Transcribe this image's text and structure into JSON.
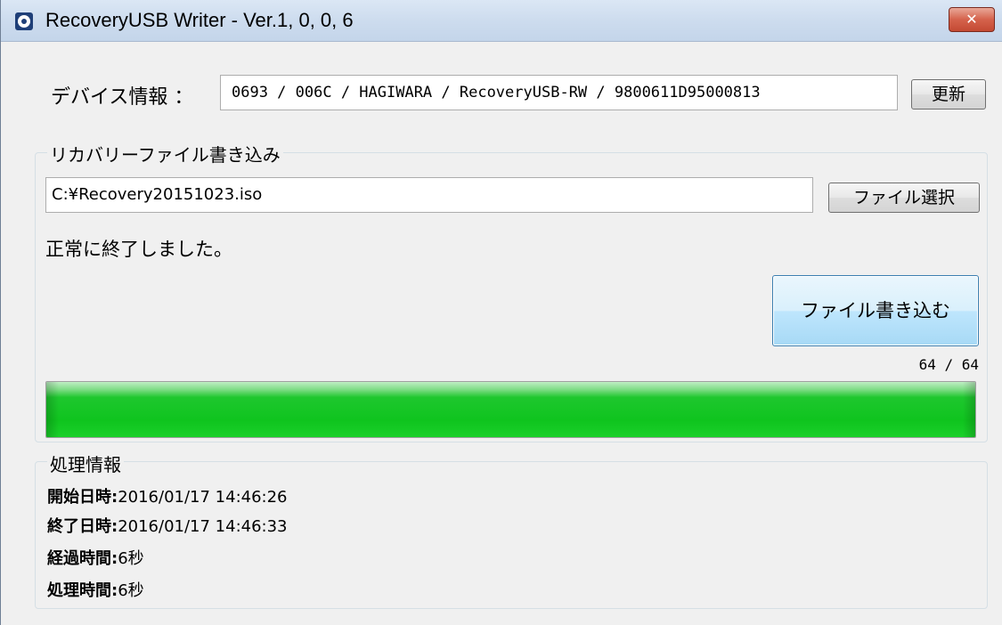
{
  "window": {
    "title": "RecoveryUSB Writer - Ver.1, 0, 0, 6",
    "close_label": "✕"
  },
  "device": {
    "label": "デバイス情報 ：",
    "value": "0693 / 006C / HAGIWARA / RecoveryUSB-RW / 9800611D95000813",
    "refresh_label": "更新"
  },
  "write_section": {
    "title": "リカバリーファイル書き込み",
    "file_path": "C:¥Recovery20151023.iso",
    "select_label": "ファイル選択",
    "status": "正常に終了しました。",
    "write_label": "ファイル書き込む",
    "count": "64 / 64",
    "progress_fraction": 1.0
  },
  "info_section": {
    "title": "処理情報",
    "lines": [
      {
        "key": "開始日時:",
        "value": "2016/01/17 14:46:26"
      },
      {
        "key": "終了日時:",
        "value": "2016/01/17 14:46:33"
      },
      {
        "key": "経過時間:",
        "value": "6秒"
      },
      {
        "key": "処理時間:",
        "value": "6秒"
      }
    ]
  }
}
